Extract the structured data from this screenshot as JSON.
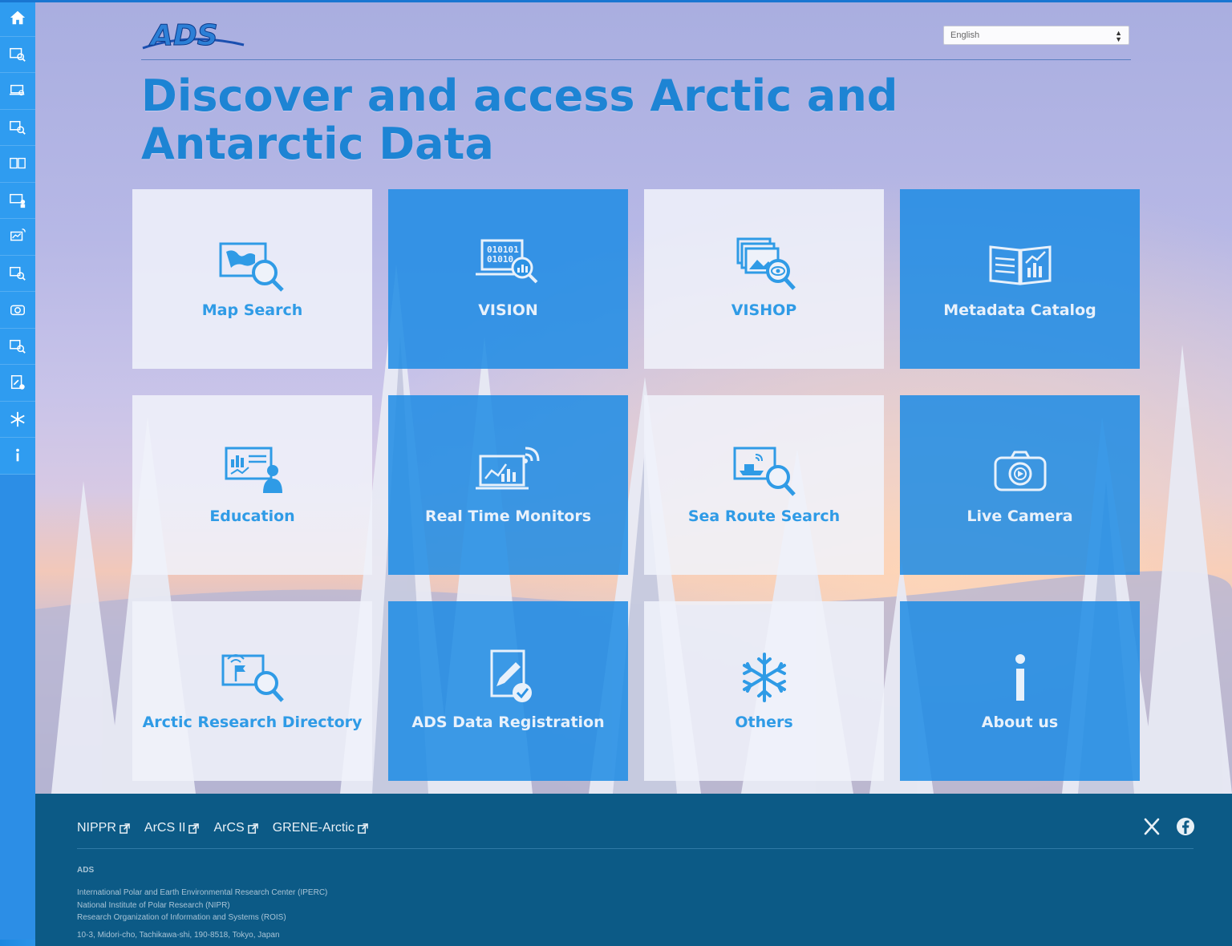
{
  "header": {
    "logo_text": "ADS",
    "language_selected": "English",
    "hero_title": "Discover and access Arctic and Antarctic Data"
  },
  "sidebar": {
    "items": [
      {
        "icon": "home-icon"
      },
      {
        "icon": "map-search-icon"
      },
      {
        "icon": "vision-icon"
      },
      {
        "icon": "vishop-icon"
      },
      {
        "icon": "metadata-catalog-icon"
      },
      {
        "icon": "education-icon"
      },
      {
        "icon": "real-time-monitor-icon"
      },
      {
        "icon": "sea-route-icon"
      },
      {
        "icon": "camera-icon"
      },
      {
        "icon": "arctic-research-icon"
      },
      {
        "icon": "data-registration-icon"
      },
      {
        "icon": "snowflake-icon"
      },
      {
        "icon": "info-icon"
      }
    ]
  },
  "tiles": [
    {
      "label": "Map Search",
      "style": "light",
      "icon": "map-search-icon"
    },
    {
      "label": "VISION",
      "style": "blue",
      "icon": "binary-laptop-icon"
    },
    {
      "label": "VISHOP",
      "style": "light",
      "icon": "image-stack-eye-icon"
    },
    {
      "label": "Metadata Catalog",
      "style": "blue",
      "icon": "open-book-chart-icon"
    },
    {
      "label": "Education",
      "style": "light",
      "icon": "teacher-board-icon"
    },
    {
      "label": "Real Time Monitors",
      "style": "blue",
      "icon": "laptop-signal-chart-icon"
    },
    {
      "label": "Sea Route Search",
      "style": "light",
      "icon": "ship-search-icon"
    },
    {
      "label": "Live Camera",
      "style": "blue",
      "icon": "camera-icon"
    },
    {
      "label": "Arctic Research Directory",
      "style": "light",
      "icon": "flag-search-icon"
    },
    {
      "label": "ADS Data Registration",
      "style": "blue",
      "icon": "document-pen-check-icon"
    },
    {
      "label": "Others",
      "style": "light",
      "icon": "snowflake-icon"
    },
    {
      "label": "About us",
      "style": "blue",
      "icon": "info-icon"
    }
  ],
  "footer": {
    "links": [
      "NIPPR",
      "ArCS II",
      "ArCS",
      "GRENE-Arctic"
    ],
    "org": "ADS",
    "address_lines": [
      "International Polar and Earth Environmental Research Center (IPERC)",
      "National Institute of Polar Research (NIPR)",
      "Research Organization of Information and Systems (ROIS)"
    ],
    "postal": "10-3, Midori-cho, Tachikawa-shi, 190-8518, Tokyo, Japan",
    "social": [
      "x-icon",
      "facebook-icon"
    ]
  },
  "colors": {
    "accent": "#1d84d4",
    "tile_blue": "#1e8ce4",
    "tile_light": "#f0f2fa",
    "footer_bg": "#0c5a86"
  }
}
